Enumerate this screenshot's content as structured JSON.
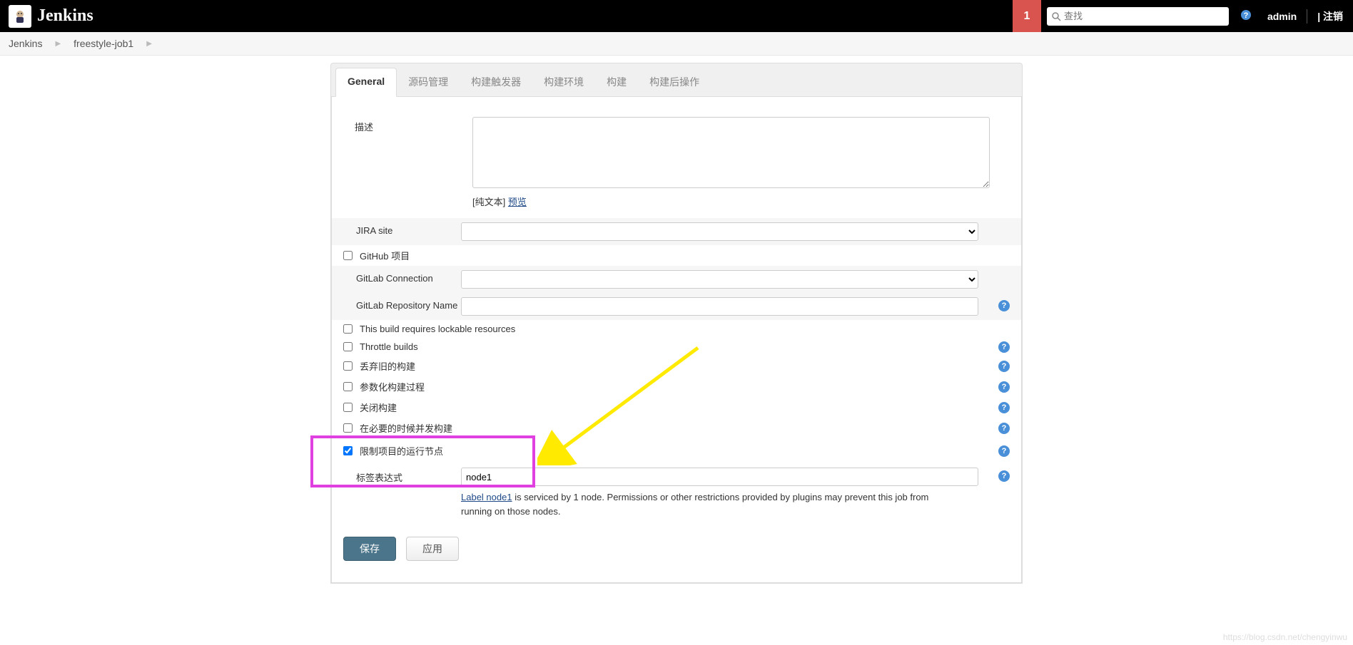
{
  "header": {
    "title": "Jenkins",
    "badge_count": "1",
    "search_placeholder": "查找",
    "user": "admin",
    "logout": "注销"
  },
  "breadcrumbs": {
    "items": [
      "Jenkins",
      "freestyle-job1"
    ]
  },
  "tabs": {
    "items": [
      "General",
      "源码管理",
      "构建触发器",
      "构建环境",
      "构建",
      "构建后操作"
    ],
    "active_index": 0
  },
  "form": {
    "description_label": "描述",
    "description_value": "",
    "desc_hint_prefix": "[纯文本] ",
    "desc_hint_link": "预览",
    "jira_label": "JIRA site",
    "github_label": "GitHub 项目",
    "gitlab_conn_label": "GitLab Connection",
    "gitlab_repo_label": "GitLab Repository Name",
    "gitlab_repo_value": "",
    "lockable_label": "This build requires lockable resources",
    "throttle_label": "Throttle builds",
    "discard_label": "丢弃旧的构建",
    "param_label": "参数化构建过程",
    "disable_label": "关闭构建",
    "concurrent_label": "在必要的时候并发构建",
    "restrict_label": "限制项目的运行节点",
    "label_expr_label": "标签表达式",
    "label_expr_value": "node1",
    "label_hint_link": "Label node1",
    "label_hint_text": " is serviced by 1 node. Permissions or other restrictions provided by plugins may prevent this job from running on those nodes."
  },
  "buttons": {
    "save": "保存",
    "apply": "应用"
  },
  "watermark": "https://blog.csdn.net/chengyinwu"
}
